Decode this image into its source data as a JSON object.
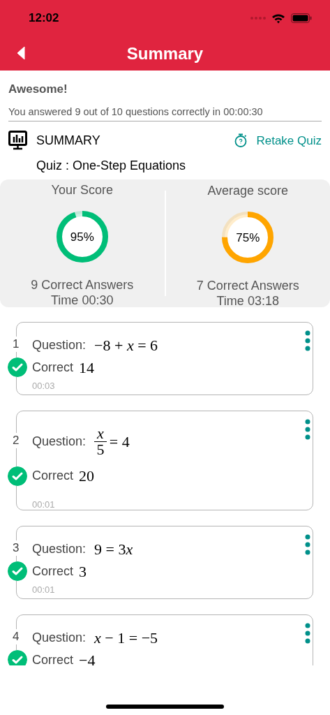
{
  "status_bar": {
    "time": "12:02"
  },
  "header": {
    "title": "Summary"
  },
  "result": {
    "heading": "Awesome!",
    "message": "You answered 9 out of 10 questions correctly in 00:00:30"
  },
  "section": {
    "title": "SUMMARY",
    "action": "Retake Quiz"
  },
  "quiz_title": "Quiz : One-Step Equations",
  "score_panels": [
    {
      "title": "Your Score",
      "percent": "95%",
      "level": 0.95,
      "color": "#00be78",
      "correct": "9 Correct Answers",
      "time": "Time 00:30"
    },
    {
      "title": "Average score",
      "percent": "75%",
      "level": 0.75,
      "color": "#ffa500",
      "correct": "7 Correct Answers",
      "time": "Time 03:18"
    }
  ],
  "questions": [
    {
      "number": "1",
      "label": "Question:",
      "kind": "inline",
      "terms": [
        {
          "kind": "text",
          "text": "−8 + "
        },
        {
          "kind": "variable",
          "text": "x"
        },
        {
          "kind": "text",
          "text": " = 6"
        }
      ],
      "correct": true,
      "result": "Correct",
      "answer": "14",
      "time": "00:03"
    },
    {
      "number": "2",
      "label": "Question:",
      "kind": "fraction",
      "numerator": "x",
      "denominator": "5",
      "rest": "= 4",
      "correct": true,
      "result": "Correct",
      "answer": "20",
      "time": "00:01"
    },
    {
      "number": "3",
      "label": "Question:",
      "kind": "inline",
      "terms": [
        {
          "kind": "text",
          "text": "9 = 3"
        },
        {
          "kind": "variable",
          "text": "x"
        }
      ],
      "correct": true,
      "result": "Correct",
      "answer": "3",
      "time": "00:01"
    },
    {
      "number": "4",
      "label": "Question:",
      "kind": "inline",
      "terms": [
        {
          "kind": "variable",
          "text": "x"
        },
        {
          "kind": "text",
          "text": " − 1 = −5"
        }
      ],
      "correct": true,
      "result": "Correct",
      "answer": "−4"
    }
  ]
}
